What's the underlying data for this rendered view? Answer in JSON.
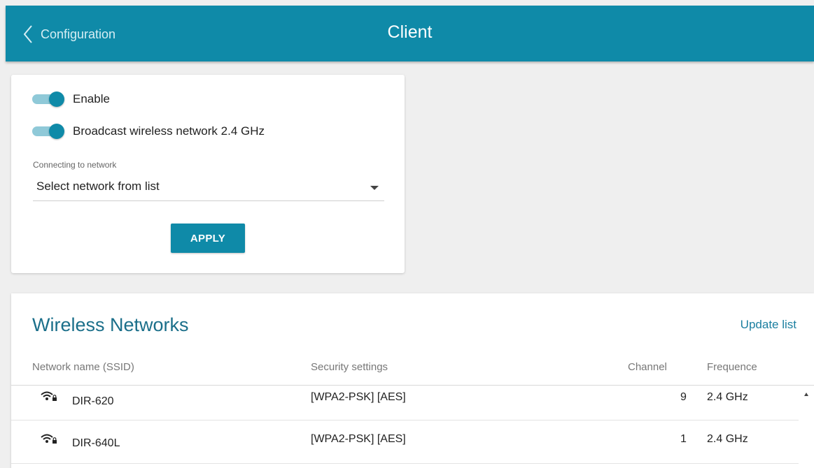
{
  "header": {
    "back_label": "Configuration",
    "title": "Client",
    "color": "#0f8aa8"
  },
  "settings": {
    "enable": {
      "label": "Enable",
      "on": true
    },
    "broadcast": {
      "label": "Broadcast wireless network 2.4 GHz",
      "on": true
    },
    "network_caption": "Connecting to network",
    "network_select_value": "Select network from list",
    "apply_label": "APPLY"
  },
  "networks": {
    "title": "Wireless Networks",
    "update_label": "Update list",
    "columns": {
      "ssid": "Network name (SSID)",
      "security": "Security settings",
      "channel": "Channel",
      "frequence": "Frequence"
    },
    "rows": [
      {
        "icon": "wifi-locked-icon",
        "ssid": "DIR-620",
        "security": "[WPA2-PSK] [AES]",
        "channel": "9",
        "frequence": "2.4 GHz"
      },
      {
        "icon": "wifi-locked-icon",
        "ssid": "DIR-640L",
        "security": "[WPA2-PSK] [AES]",
        "channel": "1",
        "frequence": "2.4 GHz"
      }
    ]
  }
}
